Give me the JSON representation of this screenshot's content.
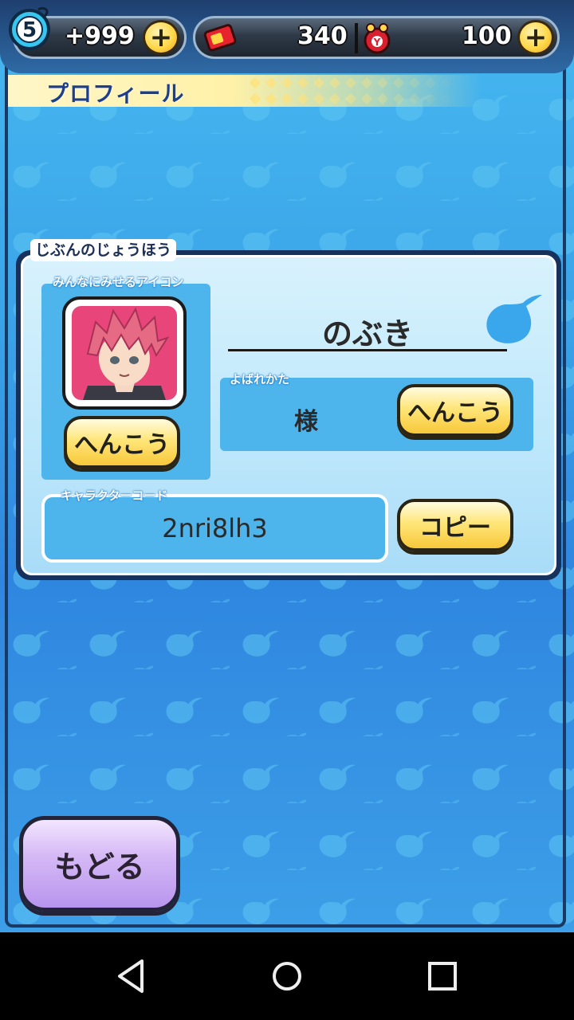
{
  "topbar": {
    "watch_level": "5",
    "stamina": "+999",
    "tickets": "340",
    "coins": "100",
    "plus_symbol": "+"
  },
  "page": {
    "title": "プロフィール"
  },
  "profile": {
    "section_label": "じぶんのじょうほう",
    "icon_label": "みんなにみせるアイコン",
    "icon_change_label": "へんこう",
    "name": "のぶき",
    "honorific_label": "よばれかた",
    "honorific_value": "様",
    "honorific_change_label": "へんこう",
    "code_label": "キャラクターコード",
    "code_value": "2nri8lh3",
    "copy_label": "コピー"
  },
  "footer": {
    "back_label": "もどる"
  },
  "colors": {
    "accent_yellow": "#ffd84a",
    "back_purple": "#c8a8f2",
    "bg_blue": "#3aa3e8"
  },
  "icons": [
    "watch-icon",
    "ticket-icon",
    "coin-purse-icon",
    "droplet-icon",
    "back-triangle-icon",
    "home-circle-icon",
    "recents-square-icon"
  ]
}
